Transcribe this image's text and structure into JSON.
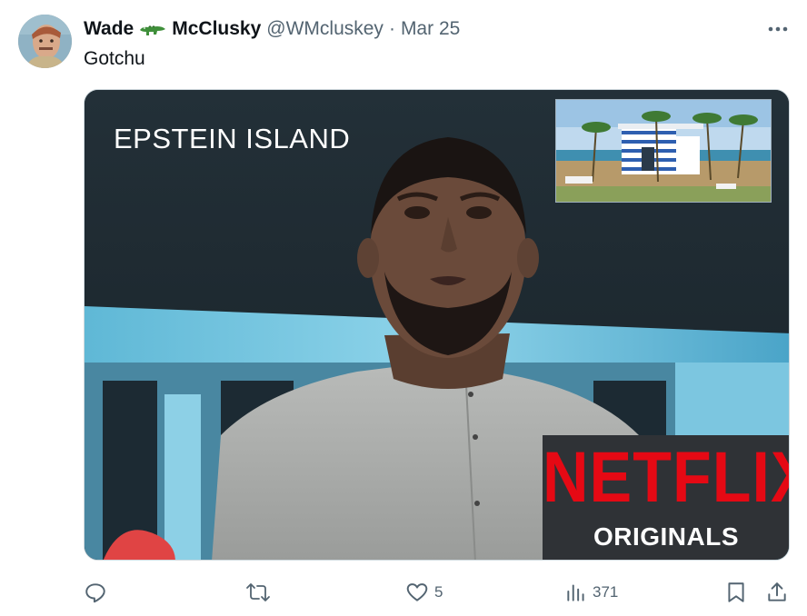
{
  "author": {
    "display_name_first": "Wade",
    "display_name_last": "McClusky",
    "handle": "@WMcluskey",
    "separator": "·",
    "date": "Mar 25"
  },
  "tweet": {
    "text": "Gotchu"
  },
  "media": {
    "caption_text": "EPSTEIN ISLAND",
    "logo_word": "NETFLIX",
    "logo_sub": "ORIGINALS"
  },
  "actions": {
    "reply_count": "",
    "retweet_count": "",
    "like_count": "5",
    "views_count": "371"
  },
  "icons": {
    "reply": "speech-bubble-icon",
    "retweet": "retweet-arrows-icon",
    "like": "heart-icon",
    "views": "bar-chart-icon",
    "bookmark": "bookmark-icon",
    "share": "share-upload-icon",
    "more": "more-dots-icon",
    "name_emoji": "crocodile-icon"
  },
  "colors": {
    "text_primary": "#0f1419",
    "text_secondary": "#536471",
    "netflix_red": "#e50914"
  }
}
